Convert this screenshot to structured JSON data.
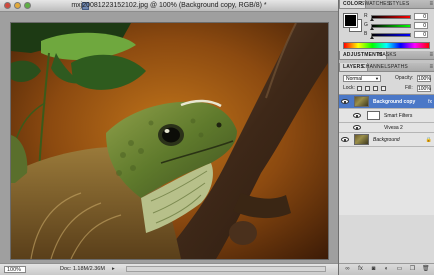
{
  "document": {
    "title": "mxj20081223152102.jpg @ 100% (Background copy, RGB/8) *",
    "zoom": "100%",
    "doc_info": "Doc: 1.18M/2.36M"
  },
  "color_panel": {
    "tabs": [
      "COLOR",
      "SWATCHES",
      "STYLES"
    ],
    "sliders": [
      {
        "label": "R",
        "value": "0"
      },
      {
        "label": "G",
        "value": "0"
      },
      {
        "label": "B",
        "value": "0"
      }
    ],
    "foreground_color": "#000000",
    "background_color": "#ffffff"
  },
  "adjustments_panel": {
    "tabs": [
      "ADJUSTMENTS",
      "MASKS"
    ]
  },
  "layers_panel": {
    "tabs": [
      "LAYERS",
      "CHANNELS",
      "PATHS"
    ],
    "blend_mode": "Normal",
    "opacity_label": "Opacity:",
    "opacity": "100%",
    "lock_label": "Lock:",
    "fill_label": "Fill:",
    "fill": "100%",
    "layers": [
      {
        "name": "Background copy",
        "selected": true,
        "extra": "fx"
      },
      {
        "name": "Smart Filters",
        "selected": false,
        "extra": ""
      },
      {
        "name": "Vivеза 2",
        "selected": false,
        "extra": ""
      },
      {
        "name": "Background",
        "selected": false,
        "extra": "🔒"
      }
    ]
  },
  "icons": {
    "window_close": "close-icon",
    "window_min": "minimize-icon",
    "window_max": "maximize-icon",
    "panel_menu": "panel-menu-icon"
  }
}
